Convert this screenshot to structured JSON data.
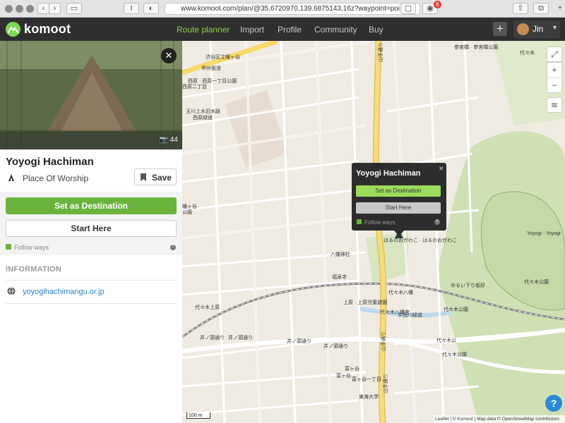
{
  "browser": {
    "url": "www.komoot.com/plan/@35.6720970,139.6875143,16z?waypoint=poi:77...",
    "extension_badge": "6"
  },
  "header": {
    "brand": "komoot",
    "nav": [
      "Route planner",
      "Import",
      "Profile",
      "Community",
      "Buy"
    ],
    "active_nav": "Route planner",
    "user_name": "Jin"
  },
  "place": {
    "photo_count": "44",
    "title": "Yoyogi Hachiman",
    "category": "Place Of Worship",
    "save_label": "Save",
    "set_destination_label": "Set as Destination",
    "start_here_label": "Start Here",
    "follow_ways_label": "Follow ways",
    "info_heading": "INFORMATION",
    "website": "yoyogihachimangu.or.jp"
  },
  "map": {
    "popup": {
      "title": "Yoyogi Hachiman",
      "set_destination_label": "Set as Destination",
      "start_here_label": "Start Here",
      "follow_ways_label": "Follow ways"
    },
    "labels": {
      "l1": "渋谷区立幡ヶ谷",
      "l2": "甲州街道",
      "l3": "西原 · 西原一丁目公園",
      "l4": "玉川上水旧水路",
      "l5": "西原緑道",
      "l6": "山手通り",
      "l7": "幡ヶ谷",
      "l8": "代々木八幡宮",
      "l9": "参宮橋 · 参宮橋公園",
      "l10": "Yoyogi · Yoyogi",
      "l11": "はるのおがわこ · はるのおがわこ",
      "l12": "八幡神社",
      "l13": "福泉寺",
      "l14": "代々木八幡",
      "l15": "上原 · 上原児童遊園",
      "l16": "代々木公園",
      "l17": "代々木上原",
      "l18": "井ノ頭通り",
      "l19": "井ノ頭通り",
      "l20": "井ノ頭通り",
      "l21": "井ノ頭通り",
      "l22": "富ヶ谷",
      "l23": "富ヶ谷",
      "l24": "ゆるい下り坂好",
      "l25": "代々木公園",
      "l26": "東海大学",
      "l27": "山手通り",
      "l28": "宇田川緑道",
      "l29": "代々木公",
      "l30": "西原二丁目",
      "l31": "公園",
      "l32": "代々木",
      "l33": "山手通り",
      "l34": "富ヶ谷一丁目",
      "l35": "代々木公園"
    },
    "scale_label": "100 m",
    "attribution": "Leaflet | © Komoot | Map data © OpenStreetMap contributors"
  },
  "colors": {
    "brand_green": "#6ab43e",
    "header_bg": "#2f2f2f",
    "link_blue": "#2a7fc4"
  }
}
